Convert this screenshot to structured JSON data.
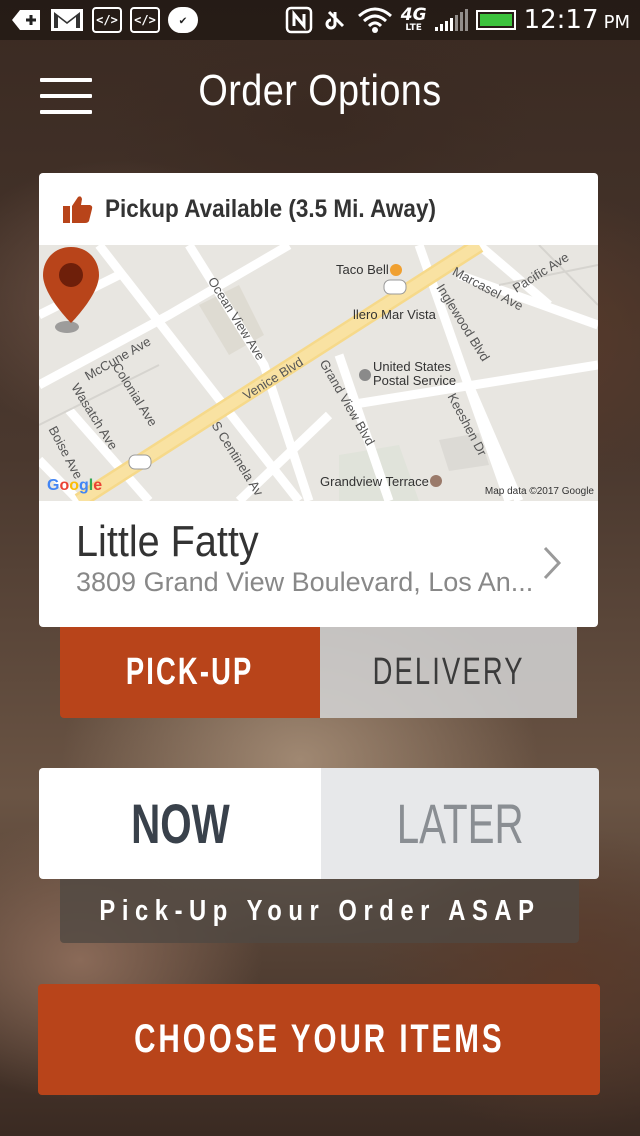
{
  "status_bar": {
    "time": "12:17",
    "ampm": "PM",
    "network": "4G",
    "network_sub": "LTE",
    "icons": [
      "plus-icon",
      "gmail-icon",
      "code-icon",
      "code-icon",
      "check-icon",
      "nfc-icon",
      "mute-icon",
      "wifi-icon",
      "signal-icon",
      "battery-icon"
    ]
  },
  "header": {
    "title": "Order Options"
  },
  "location": {
    "availability": "Pickup Available (3.5 Mi. Away)",
    "store_name": "Little Fatty",
    "address": "3809 Grand View Boulevard, Los An...",
    "map": {
      "pois": [
        "Taco Bell",
        "llero Mar Vista",
        "United States",
        "Postal Service",
        "Grandview Terrace"
      ],
      "streets": [
        "Pacific Ave",
        "Marcasel Ave",
        "Ocean View Ave",
        "Inglewood Blvd",
        "McCune Ave",
        "Colonial Ave",
        "Venice Blvd",
        "Grand View Blvd",
        "Wasatch Ave",
        "Keeshen Dr",
        "Boise Ave",
        "S Centinela Av"
      ],
      "shields": [
        "187",
        "187"
      ],
      "logo": "Google",
      "attribution": "Map data ©2017 Google"
    }
  },
  "order_type": {
    "options": [
      "PICK-UP",
      "DELIVERY"
    ],
    "selected": "PICK-UP"
  },
  "timing": {
    "options": [
      "NOW",
      "LATER"
    ],
    "selected": "NOW",
    "note": "Pick-Up Your Order ASAP"
  },
  "cta": {
    "label": "CHOOSE YOUR ITEMS"
  },
  "colors": {
    "accent": "#b8441a",
    "dark_text": "#39414b",
    "muted_text": "#8a8e93"
  }
}
